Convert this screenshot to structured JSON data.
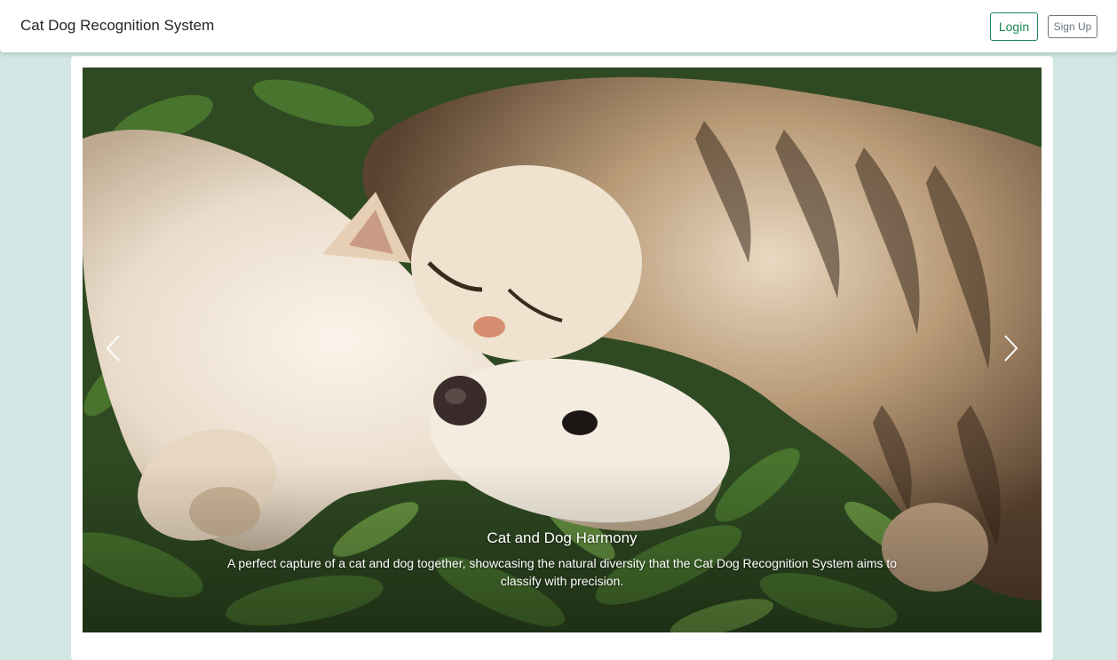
{
  "navbar": {
    "brand": "Cat Dog Recognition System",
    "login_label": "Login",
    "signup_label": "Sign Up"
  },
  "carousel": {
    "slide": {
      "image_alt": "cat and dog lying together in grass",
      "title": "Cat and Dog Harmony",
      "text": "A perfect capture of a cat and dog together, showcasing the natural diversity that the Cat Dog Recognition System aims to classify with precision."
    },
    "prev_icon": "chevron-left-icon",
    "next_icon": "chevron-right-icon"
  },
  "colors": {
    "page_background": "#d2e7e4",
    "login_accent": "#198754",
    "signup_accent": "#6c757d"
  }
}
